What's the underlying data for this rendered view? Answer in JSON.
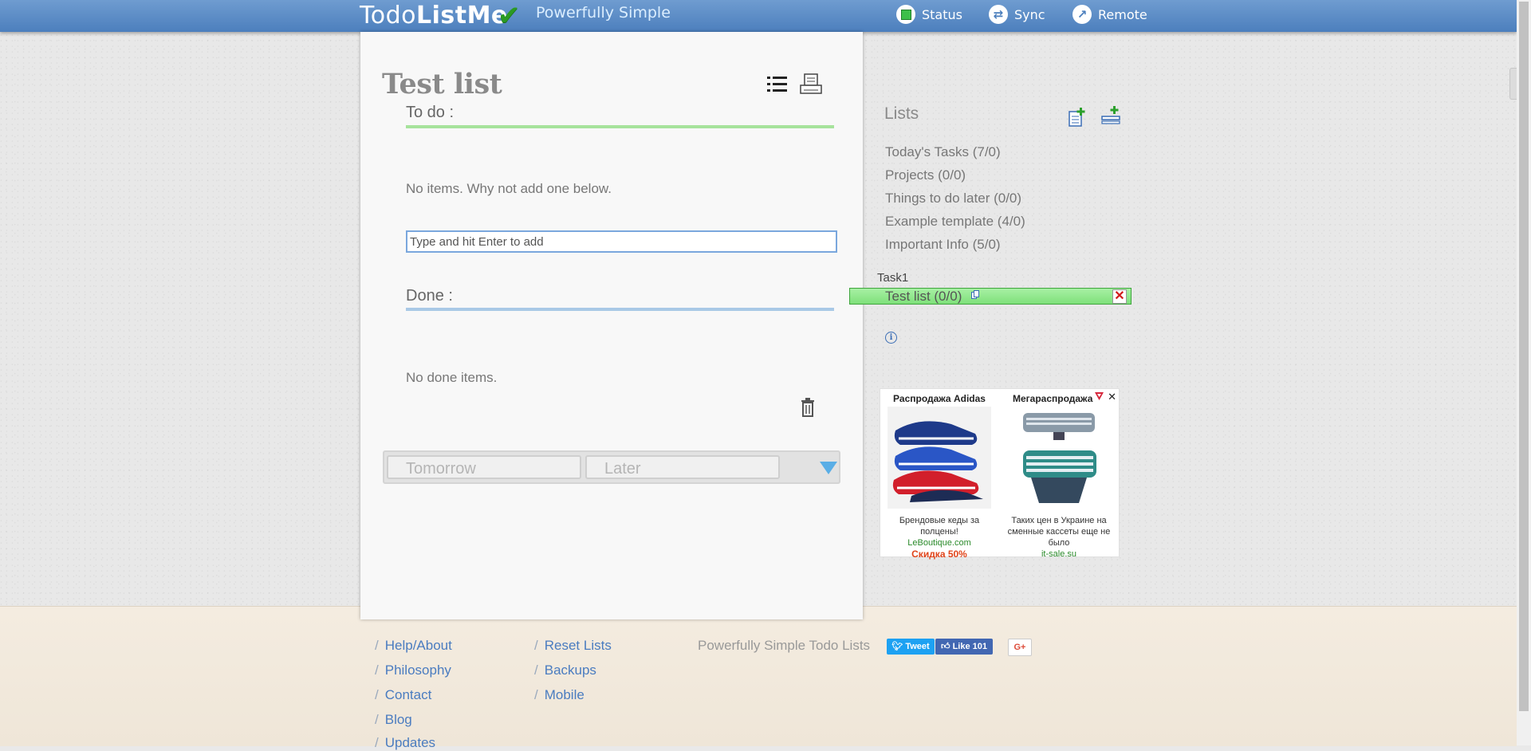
{
  "header": {
    "logo_light": "Todo",
    "logo_bold": "ListMe",
    "slogan": "Powerfully Simple",
    "nav": [
      {
        "label": "Status",
        "icon": "status-icon"
      },
      {
        "label": "Sync",
        "icon": "sync-icon"
      },
      {
        "label": "Remote",
        "icon": "remote-icon"
      }
    ]
  },
  "list": {
    "title": "Test list",
    "todo_label": "To do :",
    "todo_empty": "No items. Why not add one below.",
    "add_placeholder": "Type and hit Enter to add",
    "done_label": "Done :",
    "done_empty": "No done items.",
    "schedule": {
      "tomorrow": "Tomorrow",
      "later": "Later"
    }
  },
  "sidebar": {
    "title": "Lists",
    "lists": [
      "Today's Tasks (7/0)",
      "Projects (0/0)",
      "Things to do later (0/0)",
      "Example template (4/0)",
      "Important Info (5/0)"
    ],
    "group": "Task1",
    "active_list": "Test list (0/0)"
  },
  "ad": {
    "left": {
      "headline": "Распродажа Adidas",
      "text": "Брендовые кеды за полцены!",
      "domain": "LeBoutique.com",
      "promo": "Скидка 50%"
    },
    "right": {
      "headline": "Мегараспродажа",
      "text": "Таких цен в Украине на сменные кассеты еще не было",
      "domain": "it-sale.su"
    }
  },
  "footer": {
    "col1": [
      "Help/About",
      "Philosophy",
      "Contact",
      "Blog",
      "Updates"
    ],
    "col2": [
      "Reset Lists",
      "Backups",
      "Mobile"
    ],
    "tagline": "Powerfully Simple Todo Lists",
    "social": {
      "tweet": "Tweet",
      "like": "Like 101",
      "gplus": "G+"
    }
  },
  "colors": {
    "header": "#4c7fbd",
    "todo_rule": "#a6e39c",
    "done_rule": "#a9c9e6",
    "active_list": "#8fe68a",
    "link": "#4a7cc0"
  }
}
